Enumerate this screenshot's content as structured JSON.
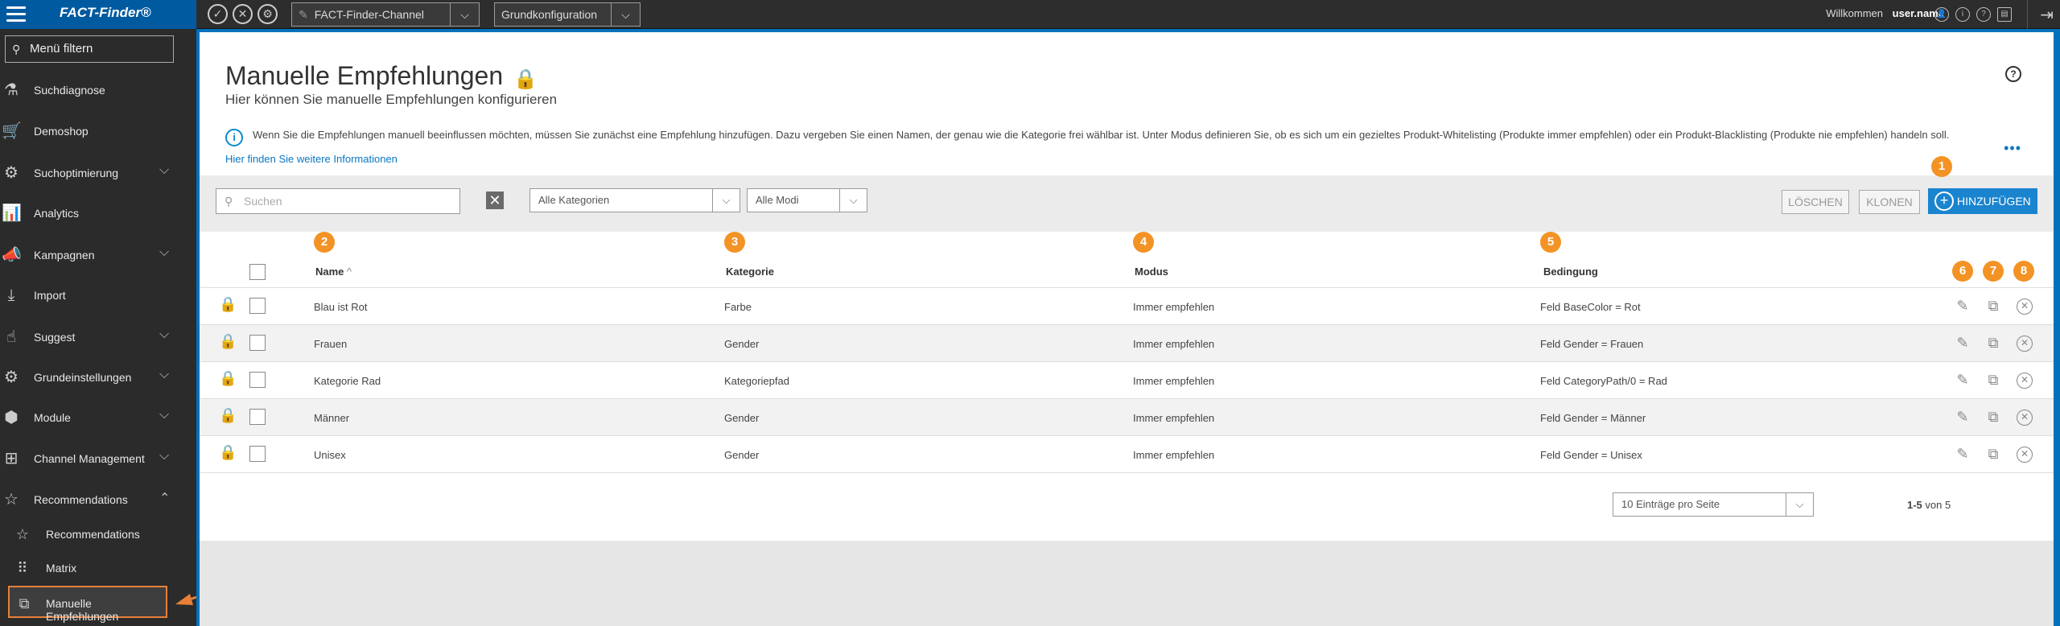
{
  "topbar": {
    "logo": "FACT-Finder®",
    "channel_select": "FACT-Finder-Channel",
    "config_select": "Grundkonfiguration",
    "welcome": "Willkommen",
    "username": "user.name"
  },
  "sidebar": {
    "filter_placeholder": "Menü filtern",
    "items": [
      {
        "label": "Suchdiagnose",
        "icon": "flask-icon",
        "expandable": false
      },
      {
        "label": "Demoshop",
        "icon": "cart-icon",
        "expandable": false
      },
      {
        "label": "Suchoptimierung",
        "icon": "gear-icon",
        "expandable": true
      },
      {
        "label": "Analytics",
        "icon": "chart-icon",
        "expandable": false
      },
      {
        "label": "Kampagnen",
        "icon": "megaphone-icon",
        "expandable": true
      },
      {
        "label": "Import",
        "icon": "download-icon",
        "expandable": false
      },
      {
        "label": "Suggest",
        "icon": "hand-icon",
        "expandable": true
      },
      {
        "label": "Grundeinstellungen",
        "icon": "gear-icon",
        "expandable": true
      },
      {
        "label": "Module",
        "icon": "cube-icon",
        "expandable": true
      },
      {
        "label": "Channel Management",
        "icon": "sitemap-icon",
        "expandable": true
      },
      {
        "label": "Recommendations",
        "icon": "star-bubble-icon",
        "expandable": true
      }
    ],
    "subitems": [
      {
        "label": "Recommendations",
        "icon": "star-bubble-icon"
      },
      {
        "label": "Matrix",
        "icon": "grid-icon"
      },
      {
        "label": "Manuelle Empfehlungen",
        "icon": "manual-icon"
      }
    ]
  },
  "page": {
    "title": "Manuelle Empfehlungen",
    "subtitle": "Hier können Sie manuelle Empfehlungen konfigurieren",
    "info_text": "Wenn Sie die Empfehlungen manuell beeinflussen möchten, müssen Sie zunächst eine Empfehlung hinzufügen. Dazu vergeben Sie einen Namen, der genau wie die Kategorie frei wählbar ist. Unter Modus definieren Sie, ob es sich um ein gezieltes Produkt-Whitelisting (Produkte immer empfehlen) oder ein Produkt-Blacklisting (Produkte nie empfehlen) handeln soll.",
    "info_link": "Hier finden Sie weitere Informationen"
  },
  "toolbar": {
    "search_placeholder": "Suchen",
    "category_filter": "Alle Kategorien",
    "mode_filter": "Alle Modi",
    "delete_label": "LÖSCHEN",
    "clone_label": "KLONEN",
    "add_label": "HINZUFÜGEN"
  },
  "table": {
    "columns": [
      "Name",
      "Kategorie",
      "Modus",
      "Bedingung"
    ],
    "rows": [
      {
        "name": "Blau ist Rot",
        "kategorie": "Farbe",
        "modus": "Immer empfehlen",
        "bedingung": "Feld BaseColor = Rot"
      },
      {
        "name": "Frauen",
        "kategorie": "Gender",
        "modus": "Immer empfehlen",
        "bedingung": "Feld Gender = Frauen"
      },
      {
        "name": "Kategorie Rad",
        "kategorie": "Kategoriepfad",
        "modus": "Immer empfehlen",
        "bedingung": "Feld CategoryPath/0 = Rad"
      },
      {
        "name": "Männer",
        "kategorie": "Gender",
        "modus": "Immer empfehlen",
        "bedingung": "Feld Gender = Männer"
      },
      {
        "name": "Unisex",
        "kategorie": "Gender",
        "modus": "Immer empfehlen",
        "bedingung": "Feld Gender = Unisex"
      }
    ]
  },
  "pagination": {
    "per_page": "10 Einträge pro Seite",
    "range": "1-5",
    "of_label": "von 5"
  },
  "badges": [
    "1",
    "2",
    "3",
    "4",
    "5",
    "6",
    "7",
    "8"
  ],
  "colors": {
    "accent": "#0071bc",
    "badge": "#f39325",
    "add_button": "#1a84cf"
  }
}
